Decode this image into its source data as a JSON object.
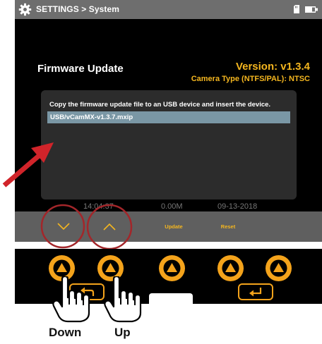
{
  "header": {
    "breadcrumb": "SETTINGS > System",
    "settings_icon": "gear-icon",
    "storage_icon": "sd-card-icon",
    "power_icon": "battery-icon"
  },
  "firmware": {
    "title": "Firmware Update",
    "version": "Version: v1.3.4",
    "camera_type": "Camera Type (NTFS/PAL): NTSC",
    "instruction": "Copy the firmware update file to an USB device and insert the device.",
    "files": [
      "USB/vCamMX-v1.3.7.mxip"
    ],
    "selected_file_index": 0
  },
  "status": {
    "time": "14:04:37",
    "size": "0.00M",
    "date": "09-13-2018"
  },
  "softkeys": [
    {
      "label": "",
      "icon": "chevron-down-icon"
    },
    {
      "label": "",
      "icon": "chevron-up-icon"
    },
    {
      "label": "Update"
    },
    {
      "label": "Reset"
    }
  ],
  "hardware": {
    "buttons": [
      "triangle-up-icon",
      "triangle-up-icon",
      "triangle-up-icon",
      "triangle-up-icon",
      "triangle-up-icon"
    ],
    "keys": [
      "back-arrow-icon",
      "enter-arrow-icon"
    ]
  },
  "captions": {
    "down": "Down",
    "up": "Up"
  },
  "colors": {
    "accent": "#f4b61f",
    "button_orange": "#f4a31b",
    "selection": "#7a97a5",
    "annotation_red": "#d1242a"
  }
}
